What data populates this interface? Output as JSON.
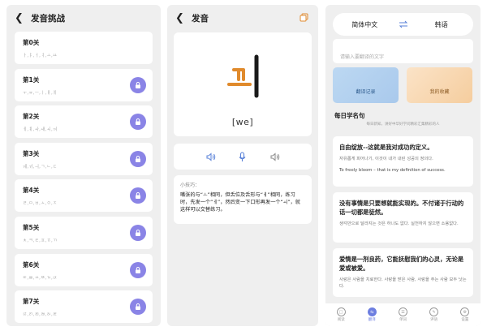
{
  "challenge": {
    "back_icon": "chevron-left-icon",
    "title": "发音挑战",
    "lessons": [
      {
        "title": "第0关",
        "chars": "ㅏ,ㅑ,ㅓ,ㅕ,ㅗ,ㅛ",
        "locked": false
      },
      {
        "title": "第1关",
        "chars": "ㅜ,ㅠ,ㅡ,ㅣ,ㅐ,ㅒ",
        "locked": true
      },
      {
        "title": "第2关",
        "chars": "ㅔ,ㅖ,ㅘ,ㅙ,ㅚ,ㅝ",
        "locked": true
      },
      {
        "title": "第3关",
        "chars": "ㅞ,ㅟ,ㅢ,ㄱ,ㄴ,ㄷ",
        "locked": true
      },
      {
        "title": "第4关",
        "chars": "ㄹ,ㅁ,ㅂ,ㅅ,ㅇ,ㅈ",
        "locked": true
      },
      {
        "title": "第5关",
        "chars": "ㅊ,ㅋ,ㅌ,ㅍ,ㅎ,ㄲ",
        "locked": true
      },
      {
        "title": "第6关",
        "chars": "ㄸ,ㅃ,ㅆ,ㅉ,ㄳ,ㄵ",
        "locked": true
      },
      {
        "title": "第7关",
        "chars": "ㄶ,ㄺ,ㄻ,ㄼ,ㄽ,ㄾ",
        "locked": true
      }
    ]
  },
  "pronunciation": {
    "title": "发音",
    "character_romanization": "[we]",
    "tip_title": "小技巧：",
    "tip_text": "嘴张的与“ㅗ”相同，但舌位及舌形与“ㅔ”相同，练习时，先发一个“ㅔ”，然后变一下口形再发一个“ㅚ”，就这样可以交替练习。"
  },
  "translate": {
    "source_lang": "简体中文",
    "target_lang": "韩语",
    "input_placeholder": "请输入要翻译的文字",
    "feature_record": "翻译记录",
    "feature_favorites": "我的收藏",
    "section_title": "每日学名句",
    "section_subtitle": "每日新知，讲好中华好学问精彩汇集精彩的人",
    "quotes": [
      {
        "zh": "自由绽放--这就是我对成功的定义。",
        "ko": "자유롭게 피어나기, 이것이 내가 내린 성공의 정의다.",
        "en": "To freely bloom – that is my definition of success."
      },
      {
        "zh": "没有事情是只要想就能实现的。不付诸于行动的话一切都是徒然。",
        "ko": "생각만으로 달라지는 것은 하나도 없다. 실천하지 않으면 소용없다.",
        "en": ""
      },
      {
        "zh": "爱情是一剂良药，它能抚慰我们的心灵，无论是爱或被爱。",
        "ko": "사랑은 사람을 치료한다. 사랑을 받은 사람, 사랑을 주는 사람 모두 낫는다.",
        "en": ""
      }
    ],
    "tabs": [
      {
        "label": "阅读",
        "icon": "book-icon",
        "active": false
      },
      {
        "label": "翻译",
        "icon": "translate-icon",
        "active": true
      },
      {
        "label": "单词",
        "icon": "word-icon",
        "active": false
      },
      {
        "label": "评语",
        "icon": "comment-icon",
        "active": false
      },
      {
        "label": "设置",
        "icon": "gear-icon",
        "active": false
      }
    ]
  },
  "colors": {
    "lock": "#8a84e6",
    "accent": "#6d7ee0",
    "glyph_dark": "#1a1a1a",
    "glyph_orange": "#e08a2c"
  }
}
